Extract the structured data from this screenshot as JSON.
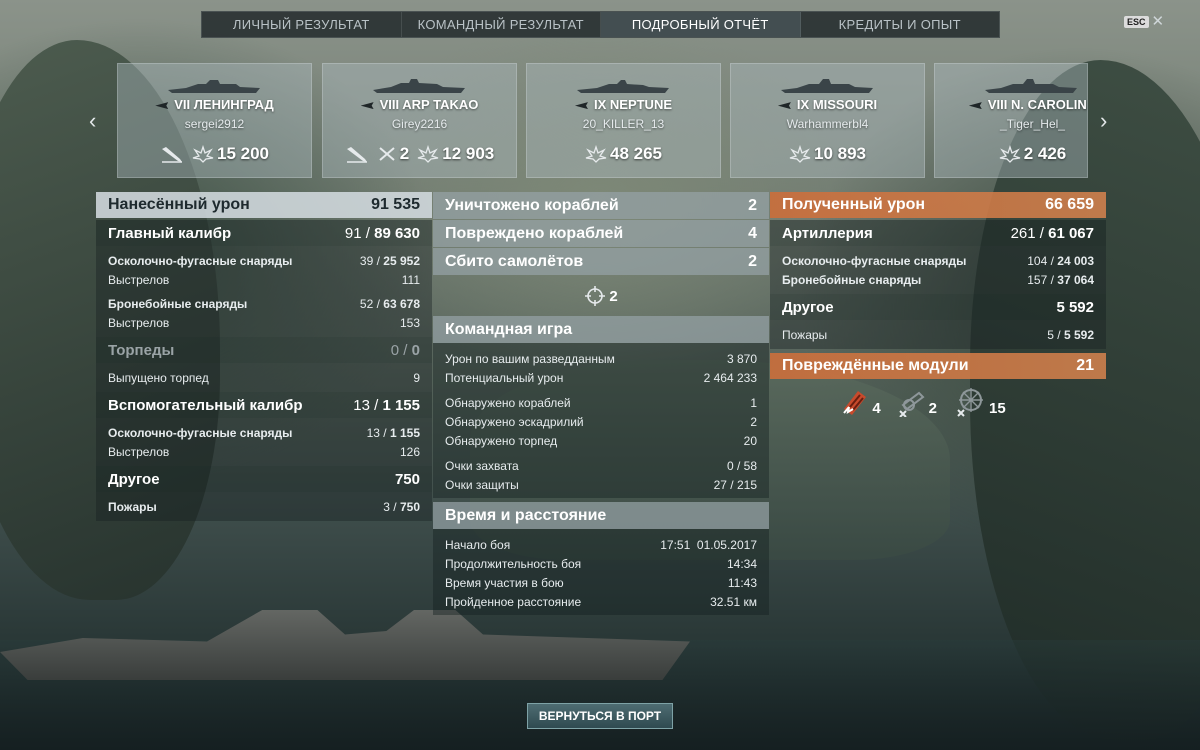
{
  "tabs": [
    {
      "label": "ЛИЧНЫЙ РЕЗУЛЬТАТ",
      "active": false
    },
    {
      "label": "КОМАНДНЫЙ РЕЗУЛЬТАТ",
      "active": false
    },
    {
      "label": "ПОДРОБНЫЙ ОТЧЁТ",
      "active": true
    },
    {
      "label": "КРЕДИТЫ И ОПЫТ",
      "active": false
    }
  ],
  "esc_label": "ESC",
  "ships": [
    {
      "tier": "VII",
      "name": "ЛЕНИНГРАД",
      "player": "sergei2912",
      "damage": "15 200",
      "kills": ""
    },
    {
      "tier": "VIII",
      "name": "ARP TAKAO",
      "player": "Girey2216",
      "kills": "2",
      "damage": "12 903"
    },
    {
      "tier": "IX",
      "name": "NEPTUNE",
      "player": "20_KILLER_13",
      "damage": "48 265"
    },
    {
      "tier": "IX",
      "name": "MISSOURI",
      "player": "Warhammerbl4",
      "damage": "10 893"
    },
    {
      "tier": "VIII",
      "name": "N. CAROLINA",
      "player": "_Tiger_Hel_",
      "damage": "2 426"
    }
  ],
  "left": {
    "header": {
      "label": "Нанесённый урон",
      "value": "91 535"
    },
    "main_cal": {
      "label": "Главный калибр",
      "hits": "91",
      "value": "89 630"
    },
    "he": {
      "label": "Осколочно-фугасные снаряды",
      "hits": "39",
      "value": "25 952"
    },
    "he_shots": {
      "label": "Выстрелов",
      "value": "111"
    },
    "ap": {
      "label": "Бронебойные снаряды",
      "hits": "52",
      "value": "63 678"
    },
    "ap_shots": {
      "label": "Выстрелов",
      "value": "153"
    },
    "torp": {
      "label": "Торпеды",
      "hits": "0",
      "value": "0"
    },
    "torp_fired": {
      "label": "Выпущено торпед",
      "value": "9"
    },
    "secondary": {
      "label": "Вспомогательный калибр",
      "hits": "13",
      "value": "1 155"
    },
    "sec_he": {
      "label": "Осколочно-фугасные снаряды",
      "hits": "13",
      "value": "1 155"
    },
    "sec_shots": {
      "label": "Выстрелов",
      "value": "126"
    },
    "other": {
      "label": "Другое",
      "value": "750"
    },
    "fires": {
      "label": "Пожары",
      "hits": "3",
      "value": "750"
    }
  },
  "mid": {
    "destroyed": {
      "label": "Уничтожено кораблей",
      "value": "2"
    },
    "damaged": {
      "label": "Повреждено кораблей",
      "value": "4"
    },
    "planes": {
      "label": "Сбито самолётов",
      "value": "2"
    },
    "planes_icon_value": "2",
    "team": {
      "title": "Командная игра",
      "rows": [
        {
          "label": "Урон по вашим разведданным",
          "value": "3 870"
        },
        {
          "label": "Потенциальный урон",
          "value": "2 464 233"
        },
        {
          "label": "Обнаружено кораблей",
          "value": "1"
        },
        {
          "label": "Обнаружено эскадрилий",
          "value": "2"
        },
        {
          "label": "Обнаружено торпед",
          "value": "20"
        },
        {
          "label": "Очки захвата",
          "value": "0 / 58"
        },
        {
          "label": "Очки защиты",
          "value": "27 / 215"
        }
      ]
    },
    "time": {
      "title": "Время и расстояние",
      "rows": [
        {
          "label": "Начало боя",
          "value": "17:51  01.05.2017"
        },
        {
          "label": "Продолжительность боя",
          "value": "14:34"
        },
        {
          "label": "Время участия в бою",
          "value": "11:43"
        },
        {
          "label": "Пройденное расстояние",
          "value": "32.51 км"
        }
      ]
    }
  },
  "right": {
    "header": {
      "label": "Полученный урон",
      "value": "66 659"
    },
    "artillery": {
      "label": "Артиллерия",
      "hits": "261",
      "value": "61 067"
    },
    "he": {
      "label": "Осколочно-фугасные снаряды",
      "hits": "104",
      "value": "24 003"
    },
    "ap": {
      "label": "Бронебойные снаряды",
      "hits": "157",
      "value": "37 064"
    },
    "other": {
      "label": "Другое",
      "value": "5 592"
    },
    "fires": {
      "label": "Пожары",
      "hits": "5",
      "value": "5 592"
    },
    "modules": {
      "label": "Повреждённые модули",
      "value": "21"
    },
    "module_icons": [
      {
        "name": "engine",
        "count": "4"
      },
      {
        "name": "turret",
        "count": "2"
      },
      {
        "name": "steering",
        "count": "15"
      }
    ]
  },
  "return_button": "ВЕРНУТЬСЯ В ПОРТ",
  "colors": {
    "orange_header": "#c96e3c",
    "button": "#3e5c62"
  }
}
